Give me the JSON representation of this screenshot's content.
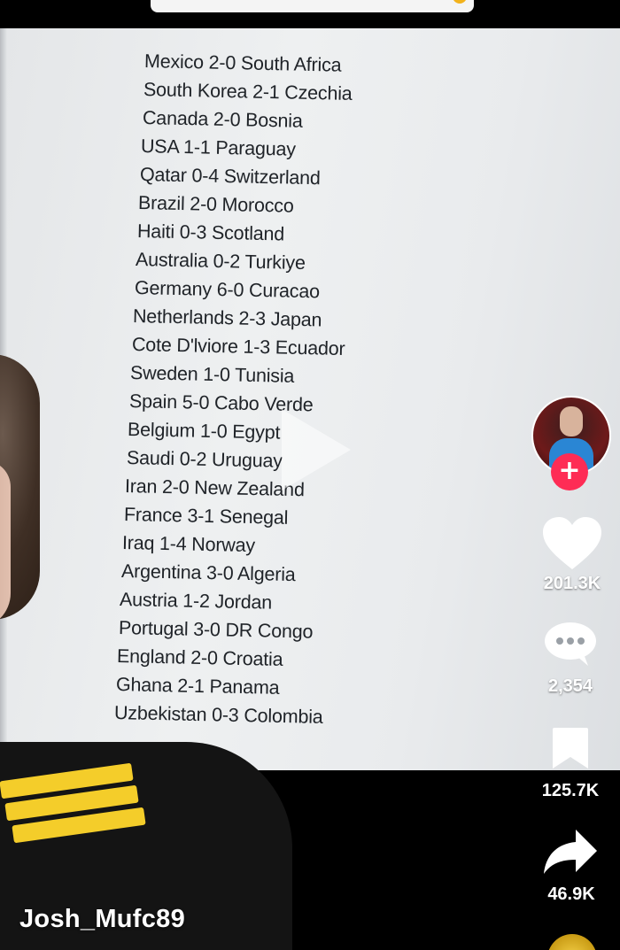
{
  "results": [
    "Mexico 2-0 South Africa",
    "South Korea 2-1 Czechia",
    "Canada 2-0 Bosnia",
    "USA 1-1 Paraguay",
    "Qatar 0-4 Switzerland",
    "Brazil 2-0 Morocco",
    "Haiti 0-3 Scotland",
    "Australia 0-2 Turkiye",
    "Germany 6-0 Curacao",
    "Netherlands 2-3 Japan",
    "Cote D'lviore 1-3 Ecuador",
    "Sweden 1-0 Tunisia",
    "Spain 5-0 Cabo Verde",
    "Belgium 1-0 Egypt",
    "Saudi 0-2 Uruguay",
    "Iran 2-0 New Zealand",
    "France 3-1 Senegal",
    "Iraq 1-4 Norway",
    "Argentina 3-0 Algeria",
    "Austria 1-2 Jordan",
    "Portugal 3-0 DR Congo",
    "England 2-0 Croatia",
    "Ghana 2-1 Panama",
    "Uzbekistan 0-3 Colombia"
  ],
  "rail": {
    "follow_symbol": "+",
    "likes": "201.3K",
    "comments": "2,354",
    "saves": "125.7K",
    "shares": "46.9K"
  },
  "author": {
    "username": "Josh_Mufc89"
  },
  "colors": {
    "follow_button": "#fe2c55",
    "jacket_stripe": "#f4cd2a"
  },
  "icons": {
    "like": "heart-icon",
    "comment": "comment-bubble-icon",
    "save": "bookmark-icon",
    "share": "share-arrow-icon",
    "play": "play-icon"
  }
}
